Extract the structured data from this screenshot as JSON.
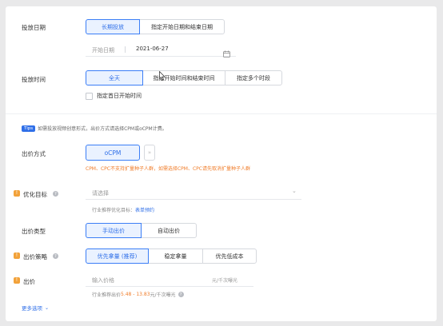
{
  "schedule": {
    "date_label": "投放日期",
    "date_options": [
      "长期投放",
      "指定开始日期和结束日期"
    ],
    "start_date_label": "开始日期",
    "start_date_value": "2021-06-27",
    "time_label": "投放时间",
    "time_options": [
      "全天",
      "指定开始时间和结束时间",
      "指定多个时段"
    ],
    "first_day_checkbox": "指定首日开始时间"
  },
  "tips": {
    "badge": "Tips",
    "text": "如需投放视频创意形式，出价方式请选择CPM或oCPM计费。"
  },
  "bid_method": {
    "label": "出价方式",
    "selected": "oCPM",
    "warning": "CPM、CPC不支持扩量种子人群，如需选择CPM、CPC请先取消扩量种子人群"
  },
  "optimization": {
    "label": "优化目标",
    "placeholder": "请选择",
    "hint_prefix": "行业推荐优化目标：",
    "hint_link": "表单预约"
  },
  "bid_type": {
    "label": "出价类型",
    "options": [
      "手动出价",
      "自动出价"
    ]
  },
  "strategy": {
    "label": "出价策略",
    "options": [
      "优先拿量 (推荐)",
      "稳定拿量",
      "优先低成本"
    ]
  },
  "price": {
    "label": "出价",
    "placeholder": "输入价格",
    "unit": "元/千次曝光",
    "hint_prefix": "行业推荐出价",
    "hint_range": "5.48 - 13.83",
    "hint_suffix": "元/千次曝光"
  },
  "more_options": "更多选项"
}
